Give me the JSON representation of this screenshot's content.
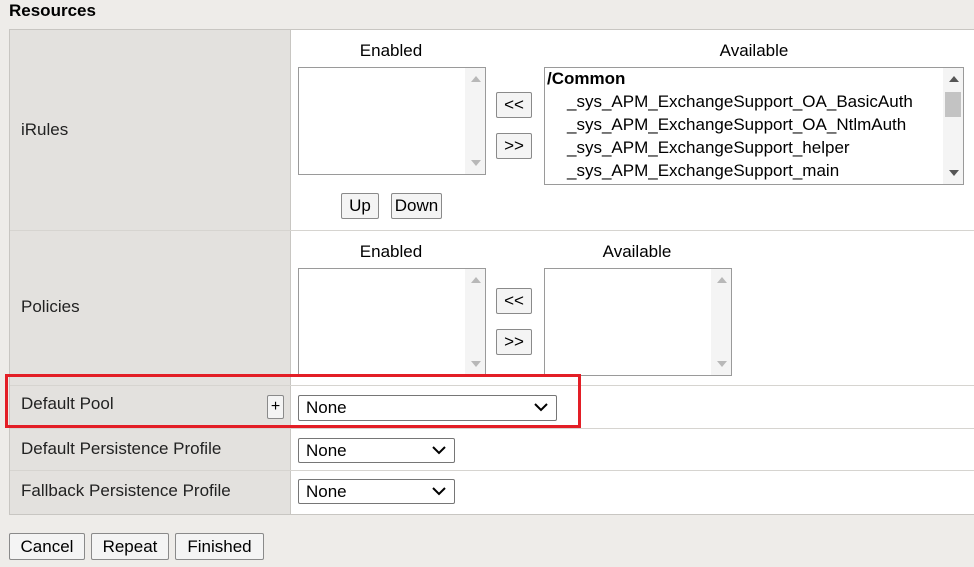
{
  "section": {
    "title": "Resources"
  },
  "irules": {
    "label": "iRules",
    "enabled_header": "Enabled",
    "available_header": "Available",
    "move_left_label": "<<",
    "move_right_label": ">>",
    "up_label": "Up",
    "down_label": "Down",
    "available_group": "/Common",
    "available_items": [
      "_sys_APM_ExchangeSupport_OA_BasicAuth",
      "_sys_APM_ExchangeSupport_OA_NtlmAuth",
      "_sys_APM_ExchangeSupport_helper",
      "_sys_APM_ExchangeSupport_main"
    ]
  },
  "policies": {
    "label": "Policies",
    "enabled_header": "Enabled",
    "available_header": "Available",
    "move_left_label": "<<",
    "move_right_label": ">>"
  },
  "default_pool": {
    "label": "Default Pool",
    "plus_label": "+",
    "value": "None"
  },
  "default_persistence": {
    "label": "Default Persistence Profile",
    "value": "None"
  },
  "fallback_persistence": {
    "label": "Fallback Persistence Profile",
    "value": "None"
  },
  "actions": {
    "cancel": "Cancel",
    "repeat": "Repeat",
    "finished": "Finished"
  },
  "colors": {
    "highlight": "#e31e26",
    "label_bg": "#e3e1de",
    "page_bg": "#eeece9"
  }
}
